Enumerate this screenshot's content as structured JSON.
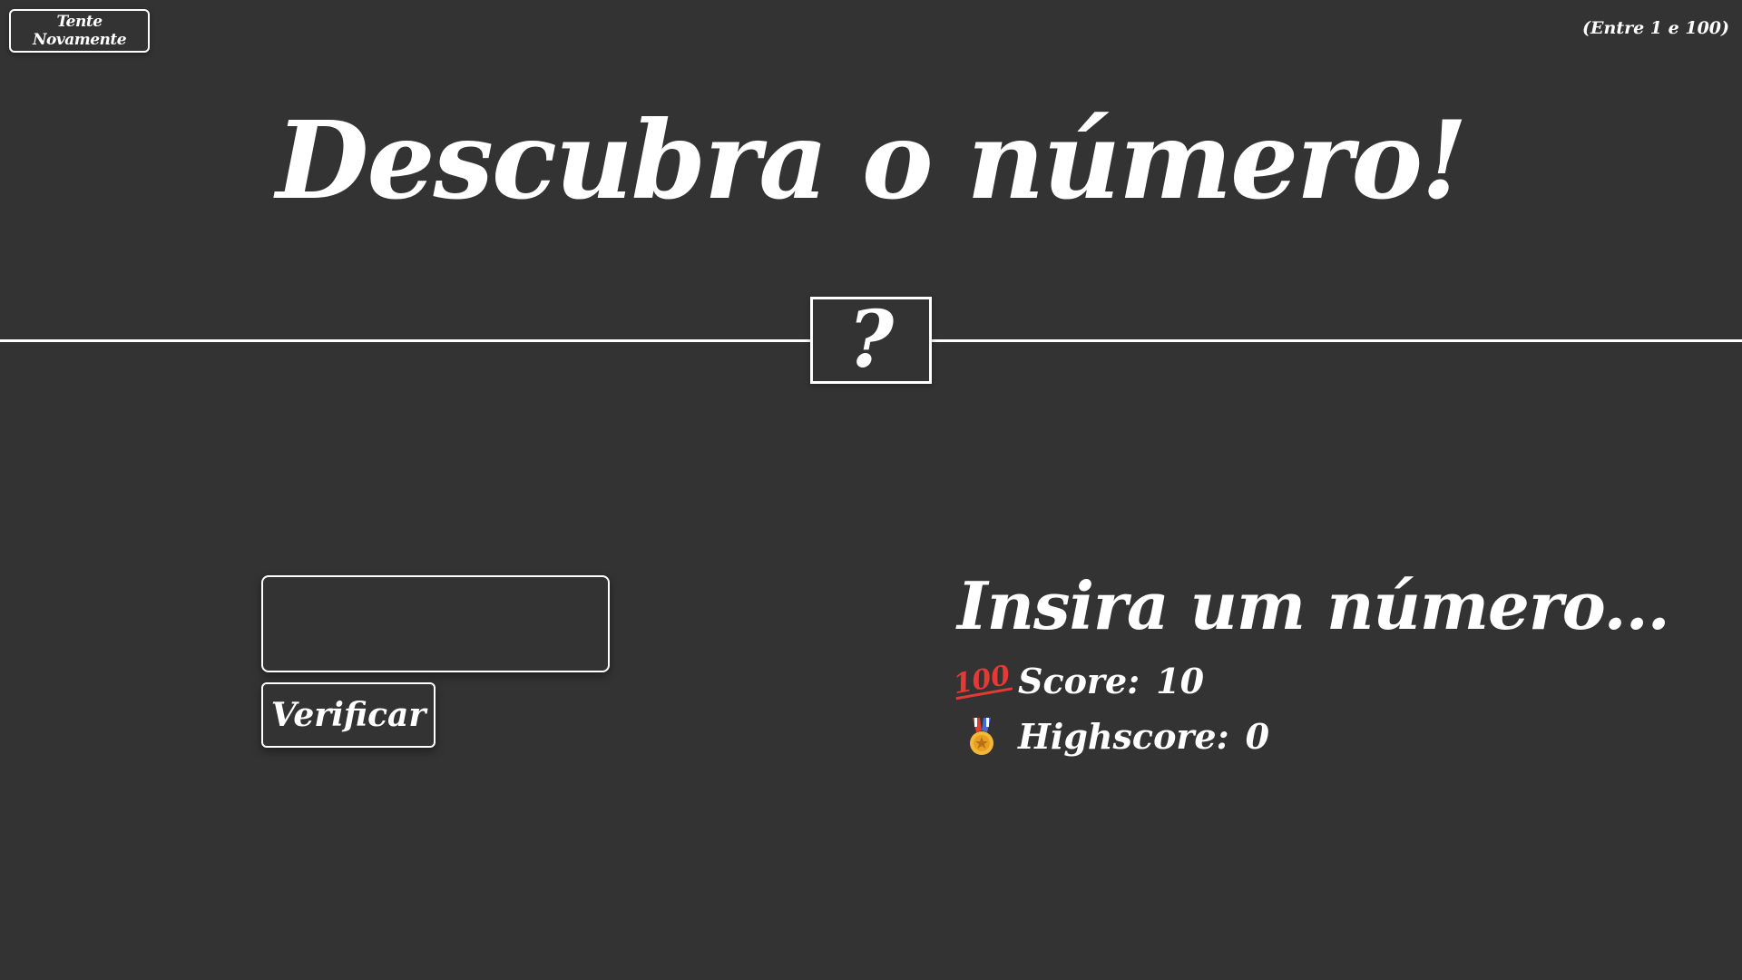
{
  "header": {
    "again_label": "Tente Novamente",
    "range_hint": "(Entre 1 e 100)"
  },
  "title": "Descubra o número!",
  "secret": {
    "display": "?"
  },
  "controls": {
    "guess_value": "",
    "check_label": "Verificar"
  },
  "status": {
    "message": "Insira um número...",
    "score_label": "Score:",
    "score_value": "10",
    "highscore_label": "Highscore:",
    "highscore_value": "0"
  },
  "icons": {
    "score": "hundred-points-icon",
    "highscore": "medal-icon"
  },
  "colors": {
    "background": "#333333",
    "foreground": "#ffffff",
    "hundred_red": "#e53935",
    "medal_gold": "#f4b73a",
    "ribbon_blue": "#3f6fd6",
    "ribbon_red": "#e53935"
  }
}
